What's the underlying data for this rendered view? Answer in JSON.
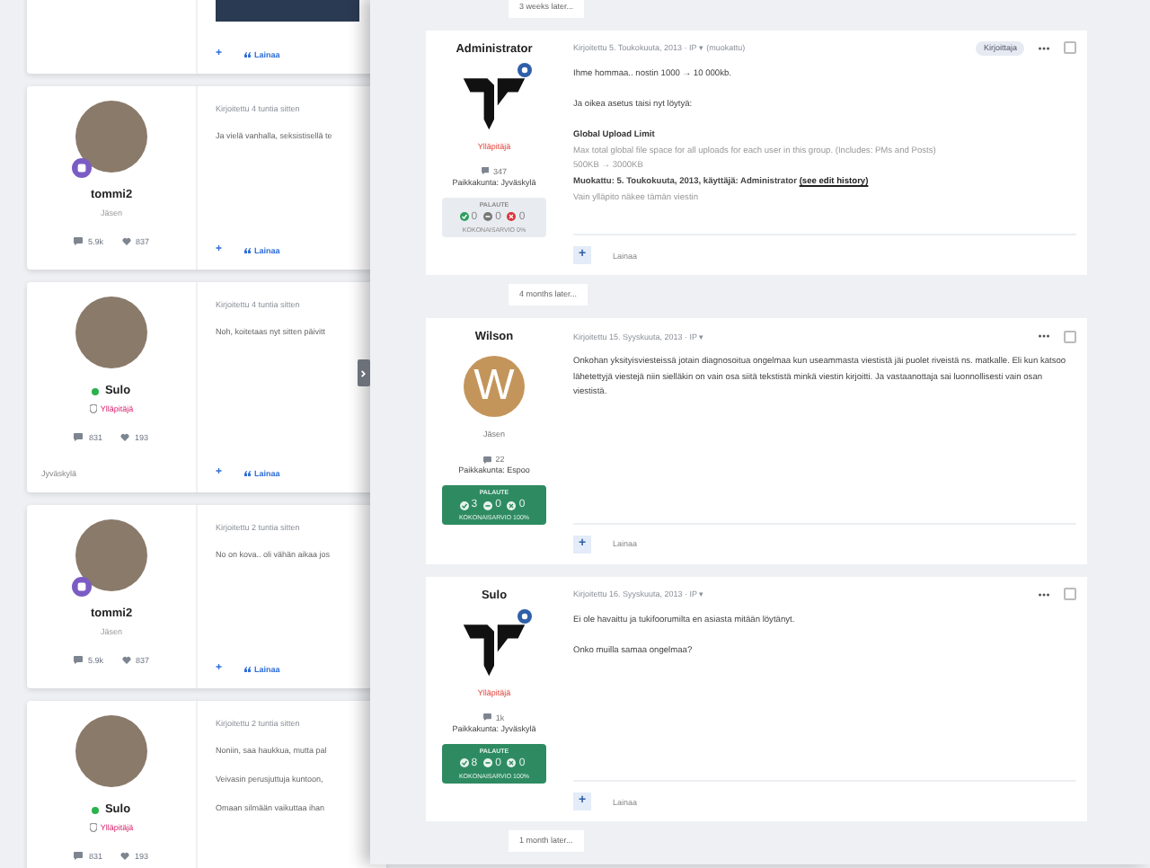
{
  "background_page": {
    "posts": [
      {
        "kind": "partial",
        "actions": {
          "add": "+",
          "quote": "Lainaa"
        }
      },
      {
        "kind": "full",
        "author": "tommi2",
        "rank_badge": true,
        "online": false,
        "role": {
          "kind": "member",
          "text": "Jäsen"
        },
        "stats": {
          "posts": "5.9k",
          "likes": "837"
        },
        "time": "Kirjoitettu 4 tuntia sitten",
        "lines": [
          "Ja vielä vanhalla, seksistisellä te"
        ],
        "actions": {
          "add": "+",
          "quote": "Lainaa"
        }
      },
      {
        "kind": "full",
        "author": "Sulo",
        "rank_badge": false,
        "online": true,
        "role": {
          "kind": "admin",
          "text": "Ylläpitäjä"
        },
        "stats": {
          "posts": "831",
          "likes": "193"
        },
        "location": "Jyväskylä",
        "time": "Kirjoitettu 4 tuntia sitten",
        "lines": [
          "Noh, koitetaas nyt sitten päivitt"
        ],
        "actions": {
          "add": "+",
          "quote": "Lainaa"
        }
      },
      {
        "kind": "full",
        "author": "tommi2",
        "rank_badge": true,
        "online": false,
        "role": {
          "kind": "member",
          "text": "Jäsen"
        },
        "stats": {
          "posts": "5.9k",
          "likes": "837"
        },
        "time": "Kirjoitettu 2 tuntia sitten",
        "lines": [
          "No on kova.. oli vähän aikaa jos"
        ],
        "actions": {
          "add": "+",
          "quote": "Lainaa"
        }
      },
      {
        "kind": "full",
        "author": "Sulo",
        "rank_badge": false,
        "online": true,
        "role": {
          "kind": "admin",
          "text": "Ylläpitäjä"
        },
        "stats": {
          "posts": "831",
          "likes": "193"
        },
        "time": "Kirjoitettu 2 tuntia sitten",
        "lines": [
          "Noniin, saa haukkua, mutta pal",
          "Veivasin perusjuttuja kuntoon,",
          "Omaan silmään vaikuttaa ihan"
        ]
      }
    ]
  },
  "panel": {
    "items": [
      {
        "kind": "separator",
        "text": "3 weeks later..."
      },
      {
        "kind": "post",
        "author": "Administrator",
        "avatar": {
          "kind": "logo"
        },
        "rank_badge": true,
        "role": {
          "kind": "admin",
          "text": "Ylläpitäjä"
        },
        "post_count": "347",
        "location": "Paikkakunta: Jyväskylä",
        "feedback": {
          "highlighted": false,
          "title": "PALAUTE",
          "positive": "0",
          "neutral": "0",
          "negative": "0",
          "total": "KOKONAISARVIO 0%"
        },
        "meta": "Kirjoitettu 5. Toukokuuta, 2013 · IP ▾ (muokattu)",
        "author_badge": "Kirjoittaja",
        "selected": false,
        "body": [
          {
            "kind": "p",
            "text": "Ihme hommaa.. nostin 1000 → 10 000kb."
          },
          {
            "kind": "p",
            "text": "Ja oikea asetus taisi nyt löytyä:"
          },
          {
            "kind": "heading",
            "text": "Global Upload Limit"
          },
          {
            "kind": "note",
            "text": "Max total global file space for all uploads for each user in this group. (Includes: PMs and Posts)"
          },
          {
            "kind": "note",
            "text": "500KB → 3000KB"
          },
          {
            "kind": "edit",
            "text": "Muokattu: 5. Toukokuuta, 2013, käyttäjä: Administrator",
            "link": "(see edit history)"
          },
          {
            "kind": "note",
            "text": "Vain ylläpito näkee tämän viestin"
          }
        ],
        "actions": {
          "add": "+",
          "quote": "Lainaa"
        }
      },
      {
        "kind": "separator",
        "text": "4 months later..."
      },
      {
        "kind": "post",
        "author": "Wilson",
        "avatar": {
          "kind": "letter",
          "letter": "W"
        },
        "rank_badge": false,
        "role": {
          "kind": "member",
          "text": "Jäsen"
        },
        "post_count": "22",
        "location": "Paikkakunta: Espoo",
        "feedback": {
          "highlighted": true,
          "title": "PALAUTE",
          "positive": "3",
          "neutral": "0",
          "negative": "0",
          "total": "KOKONAISARVIO 100%"
        },
        "meta": "Kirjoitettu 15. Syyskuuta, 2013 · IP ▾",
        "selected": false,
        "body": [
          {
            "kind": "p",
            "text": "Onkohan yksityisviesteissä jotain diagnosoitua ongelmaa kun useammasta viestistä jäi puolet riveistä ns. matkalle. Eli kun katsoo lähetettyjä viestejä niin sielläkin on vain osa siitä tekstistä minkä viestin kirjoitti. Ja vastaanottaja sai luonnollisesti vain osan viestistä."
          }
        ],
        "actions": {
          "add": "+",
          "quote": "Lainaa"
        }
      },
      {
        "kind": "post",
        "author": "Sulo",
        "avatar": {
          "kind": "logo"
        },
        "rank_badge": true,
        "role": {
          "kind": "admin",
          "text": "Ylläpitäjä"
        },
        "post_count": "1k",
        "location": "Paikkakunta: Jyväskylä",
        "feedback": {
          "highlighted": true,
          "title": "PALAUTE",
          "positive": "8",
          "neutral": "0",
          "negative": "0",
          "total": "KOKONAISARVIO 100%"
        },
        "meta": "Kirjoitettu 16. Syyskuuta, 2013 · IP ▾",
        "selected": false,
        "body": [
          {
            "kind": "p",
            "text": "Ei ole havaittu ja tukifoorumilta en asiasta mitään löytänyt."
          },
          {
            "kind": "p",
            "text": "Onko muilla samaa ongelmaa?"
          }
        ],
        "actions": {
          "add": "+",
          "quote": "Lainaa"
        }
      },
      {
        "kind": "separator",
        "text": "1 month later..."
      }
    ]
  }
}
